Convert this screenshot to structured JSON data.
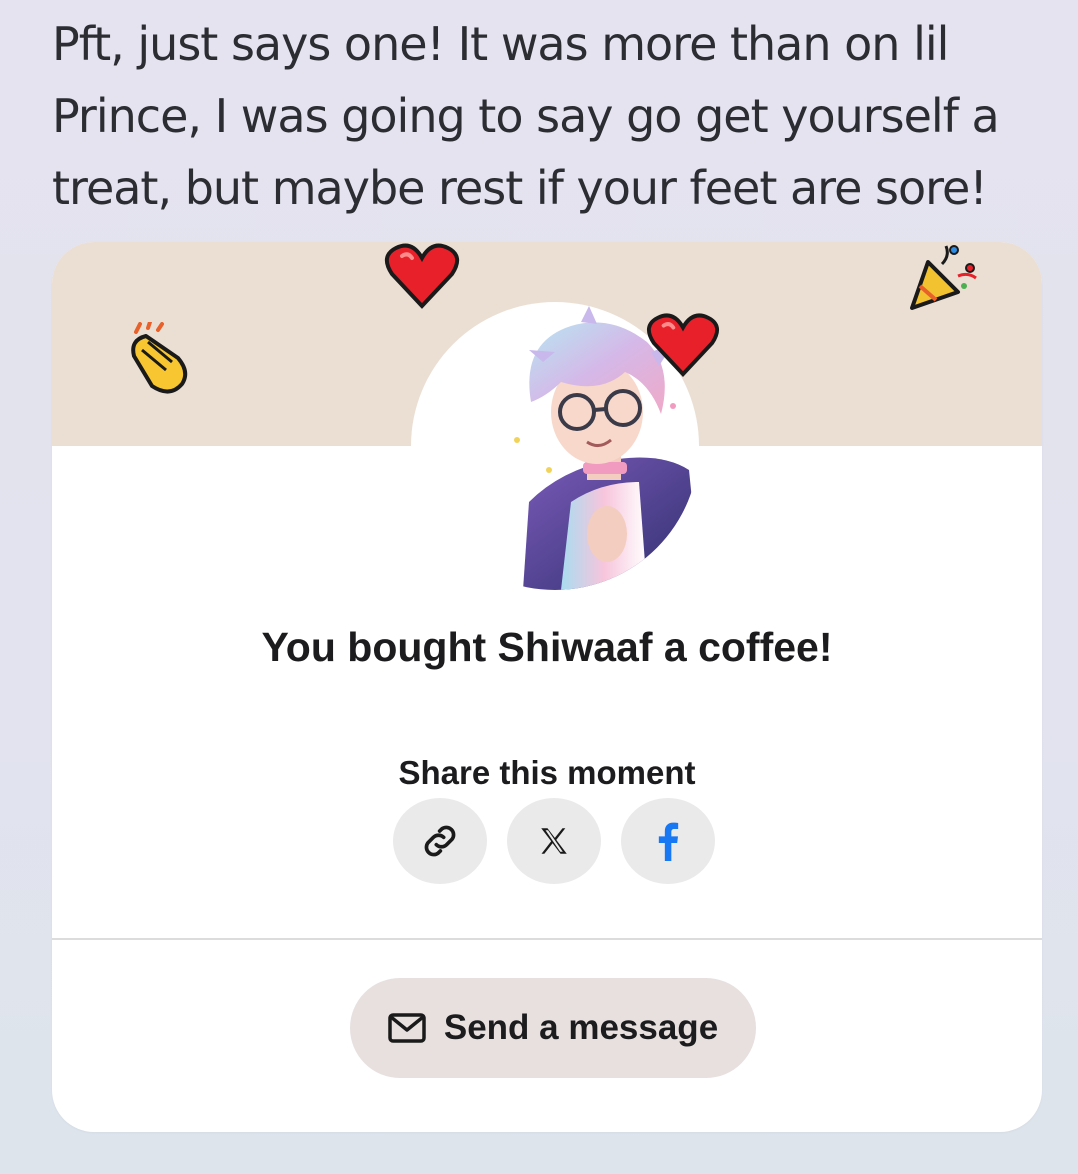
{
  "message": {
    "text": "Pft, just says one! It was more than on lil Prince, I was going to say go get yourself a treat, but maybe rest if your feet are sore!"
  },
  "card": {
    "title": "You bought Shiwaaf a coffee!",
    "share_label": "Share this moment",
    "share_buttons": [
      {
        "name": "copy-link",
        "icon": "link-icon"
      },
      {
        "name": "share-x",
        "icon": "x-logo-icon"
      },
      {
        "name": "share-facebook",
        "icon": "facebook-icon"
      }
    ],
    "send_message_label": "Send a message",
    "banner_emojis": [
      "heart-icon",
      "party-popper-icon",
      "clapping-hands-icon",
      "heart-icon"
    ]
  },
  "colors": {
    "background": "#e3e3ee",
    "banner": "#ebdfd4",
    "card": "#ffffff",
    "share_button_bg": "#eaeaea",
    "send_button_bg": "#e7e0df",
    "facebook_blue": "#1877f2",
    "heart_red": "#e8202a"
  }
}
